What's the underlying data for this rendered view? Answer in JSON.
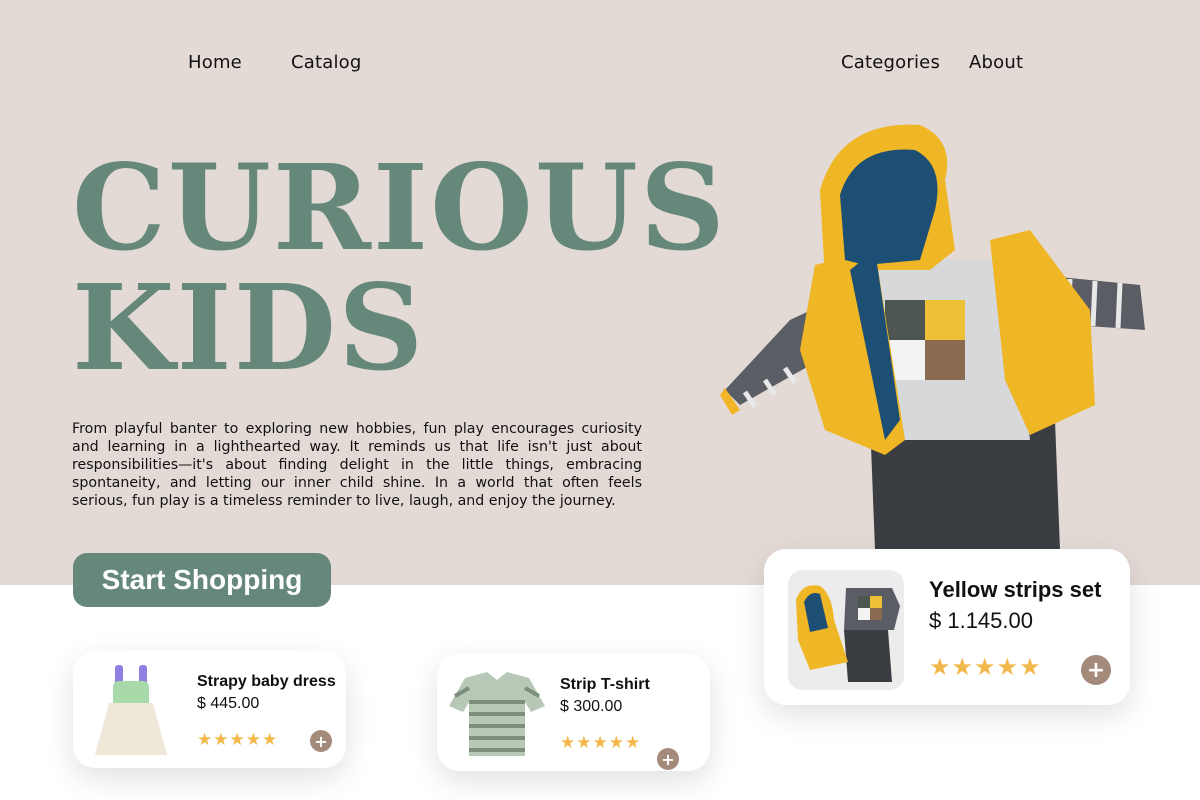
{
  "nav": {
    "home": "Home",
    "catalog": "Catalog",
    "categories": "Categories",
    "about": "About"
  },
  "hero": {
    "title_line1": "CURIOUS",
    "title_line2": "KIDS",
    "description": "From playful banter to exploring new hobbies, fun play encourages curiosity and learning in a lighthearted way. It reminds us that life isn't just about responsibilities—it's about finding delight in the little things, embracing spontaneity, and letting our inner child shine. In a world that often feels serious, fun play is a timeless reminder to live, laugh, and enjoy the journey.",
    "cta_label": "Start Shopping"
  },
  "products": [
    {
      "name": "Strapy baby dress",
      "price": "$ 445.00",
      "stars": "★★★★★",
      "rating": 5,
      "add_icon": "plus-icon"
    },
    {
      "name": "Strip T-shirt",
      "price": "$ 300.00",
      "stars": "★★★★★",
      "rating": 5,
      "add_icon": "plus-icon"
    },
    {
      "name": "Yellow strips set",
      "price": "$ 1.145.00",
      "stars": "★★★★★",
      "rating": 5,
      "add_icon": "plus-icon"
    }
  ],
  "colors": {
    "hero_bg": "#e3dad6",
    "accent_green": "#65887a",
    "star_yellow": "#f2b84b",
    "add_button": "#a48a7b"
  }
}
